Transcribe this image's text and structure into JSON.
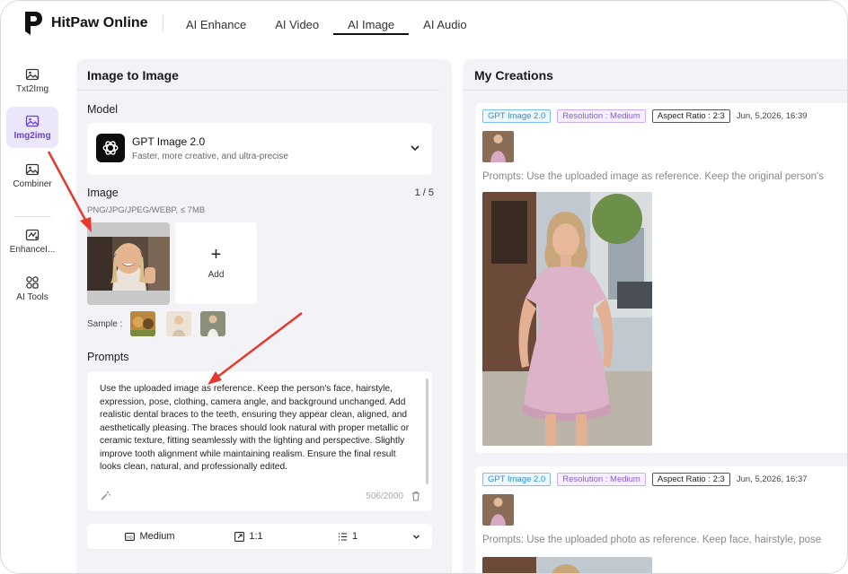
{
  "brand": {
    "name": "HitPaw Online"
  },
  "nav": [
    {
      "label": "AI Enhance",
      "active": false
    },
    {
      "label": "AI Video",
      "active": false
    },
    {
      "label": "AI Image",
      "active": true
    },
    {
      "label": "AI Audio",
      "active": false
    }
  ],
  "sidebar": [
    {
      "label": "Txt2Img",
      "icon": "image-icon",
      "active": false
    },
    {
      "label": "Img2img",
      "icon": "image-icon",
      "active": true
    },
    {
      "label": "Combiner",
      "icon": "image-icon",
      "active": false
    },
    {
      "label": "EnhanceI...",
      "icon": "enhance-icon",
      "active": false
    },
    {
      "label": "AI Tools",
      "icon": "tools-icon",
      "active": false
    }
  ],
  "left": {
    "title": "Image to Image",
    "model_label": "Model",
    "model": {
      "name": "GPT Image 2.0",
      "desc": "Faster, more creative, and ultra-precise"
    },
    "image_label": "Image",
    "image_count": "1 / 5",
    "formats": "PNG/JPG/JPEG/WEBP, ≤ 7MB",
    "add_label": "Add",
    "sample_label": "Sample :",
    "prompts_label": "Prompts",
    "prompt": "Use the uploaded image as reference. Keep the person's face, hairstyle, expression, pose, clothing, camera angle, and background unchanged. Add realistic dental braces to the teeth, ensuring they appear clean, aligned, and aesthetically pleasing. The braces should look natural with proper metallic or ceramic texture, fitting seamlessly with the lighting and perspective. Slightly improve tooth alignment while maintaining realism. Ensure the final result looks clean, natural, and professionally edited.",
    "char_count": "506/2000",
    "options": {
      "quality": "Medium",
      "ratio": "1:1",
      "count": "1"
    }
  },
  "right": {
    "title": "My Creations",
    "cards": [
      {
        "model": "GPT Image 2.0",
        "resolution": "Resolution : Medium",
        "aspect": "Aspect Ratio : 2:3",
        "time": "Jun, 5,2026, 16:39",
        "prompt": "Prompts: Use the uploaded image as reference. Keep the original person's"
      },
      {
        "model": "GPT Image 2.0",
        "resolution": "Resolution : Medium",
        "aspect": "Aspect Ratio : 2:3",
        "time": "Jun, 5,2026, 16:37",
        "prompt": "Prompts: Use the uploaded photo as reference. Keep face, hairstyle, pose"
      }
    ]
  },
  "colors": {
    "accent": "#6b3ee0",
    "panel_bg": "#f2f2f7",
    "arrow": "#e8372c"
  }
}
